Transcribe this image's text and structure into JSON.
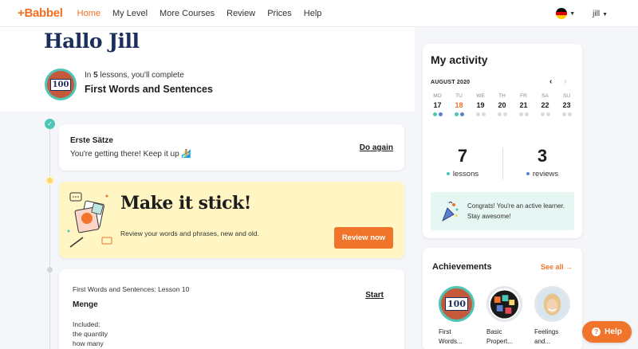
{
  "nav": {
    "logo": "+Babbel",
    "links": [
      "Home",
      "My Level",
      "More Courses",
      "Review",
      "Prices",
      "Help"
    ],
    "active": "Home",
    "user": "jill"
  },
  "header": {
    "greeting": "Hallo Jill",
    "badge_number": "100",
    "progress_prefix": "In ",
    "progress_count": "5",
    "progress_suffix": " lessons, you'll complete",
    "course_title": "First Words and Sentences"
  },
  "lesson_done": {
    "title": "Erste Sätze",
    "subtitle": "You're getting there! Keep it up 🏄",
    "action": "Do again"
  },
  "review_card": {
    "title": "Make it stick!",
    "subtitle": "Review your words and phrases, new and old.",
    "button": "Review now"
  },
  "next_lesson": {
    "path": "First Words and Sentences: Lesson 10",
    "title": "Menge",
    "included_label": "Included:",
    "included": [
      "the quantity",
      "how many"
    ],
    "action": "Start"
  },
  "activity": {
    "title": "My activity",
    "month": "AUGUST 2020",
    "days": [
      {
        "name": "MO",
        "date": "17",
        "dots": [
          "#4ec5b5",
          "#5b7fd1"
        ],
        "today": false
      },
      {
        "name": "TU",
        "date": "18",
        "dots": [
          "#4ec5b5",
          "#5b7fd1"
        ],
        "today": true
      },
      {
        "name": "WE",
        "date": "19",
        "dots": [
          "#d8dce2",
          "#d8dce2"
        ],
        "today": false
      },
      {
        "name": "TH",
        "date": "20",
        "dots": [
          "#d8dce2",
          "#d8dce2"
        ],
        "today": false
      },
      {
        "name": "FR",
        "date": "21",
        "dots": [
          "#d8dce2",
          "#d8dce2"
        ],
        "today": false
      },
      {
        "name": "SA",
        "date": "22",
        "dots": [
          "#d8dce2",
          "#d8dce2"
        ],
        "today": false
      },
      {
        "name": "SU",
        "date": "23",
        "dots": [
          "#d8dce2",
          "#d8dce2"
        ],
        "today": false
      }
    ],
    "lessons_count": "7",
    "lessons_label": "lessons",
    "reviews_count": "3",
    "reviews_label": "reviews",
    "congrats": "Congrats! You're an active learner. Stay awesome!"
  },
  "achievements": {
    "title": "Achievements",
    "see_all": "See all →",
    "items": [
      {
        "label1": "First",
        "label2": "Words...",
        "icon": "badge-100-icon"
      },
      {
        "label1": "Basic",
        "label2": "Propert...",
        "icon": "letters-icon"
      },
      {
        "label1": "Feelings",
        "label2": "and...",
        "icon": "smiling-woman-photo"
      }
    ]
  },
  "help_button": "Help",
  "colors": {
    "accent": "#f26f21",
    "teal": "#4ec5b5",
    "navy": "#1c2f5c",
    "yellow_card": "#fff6c4"
  }
}
